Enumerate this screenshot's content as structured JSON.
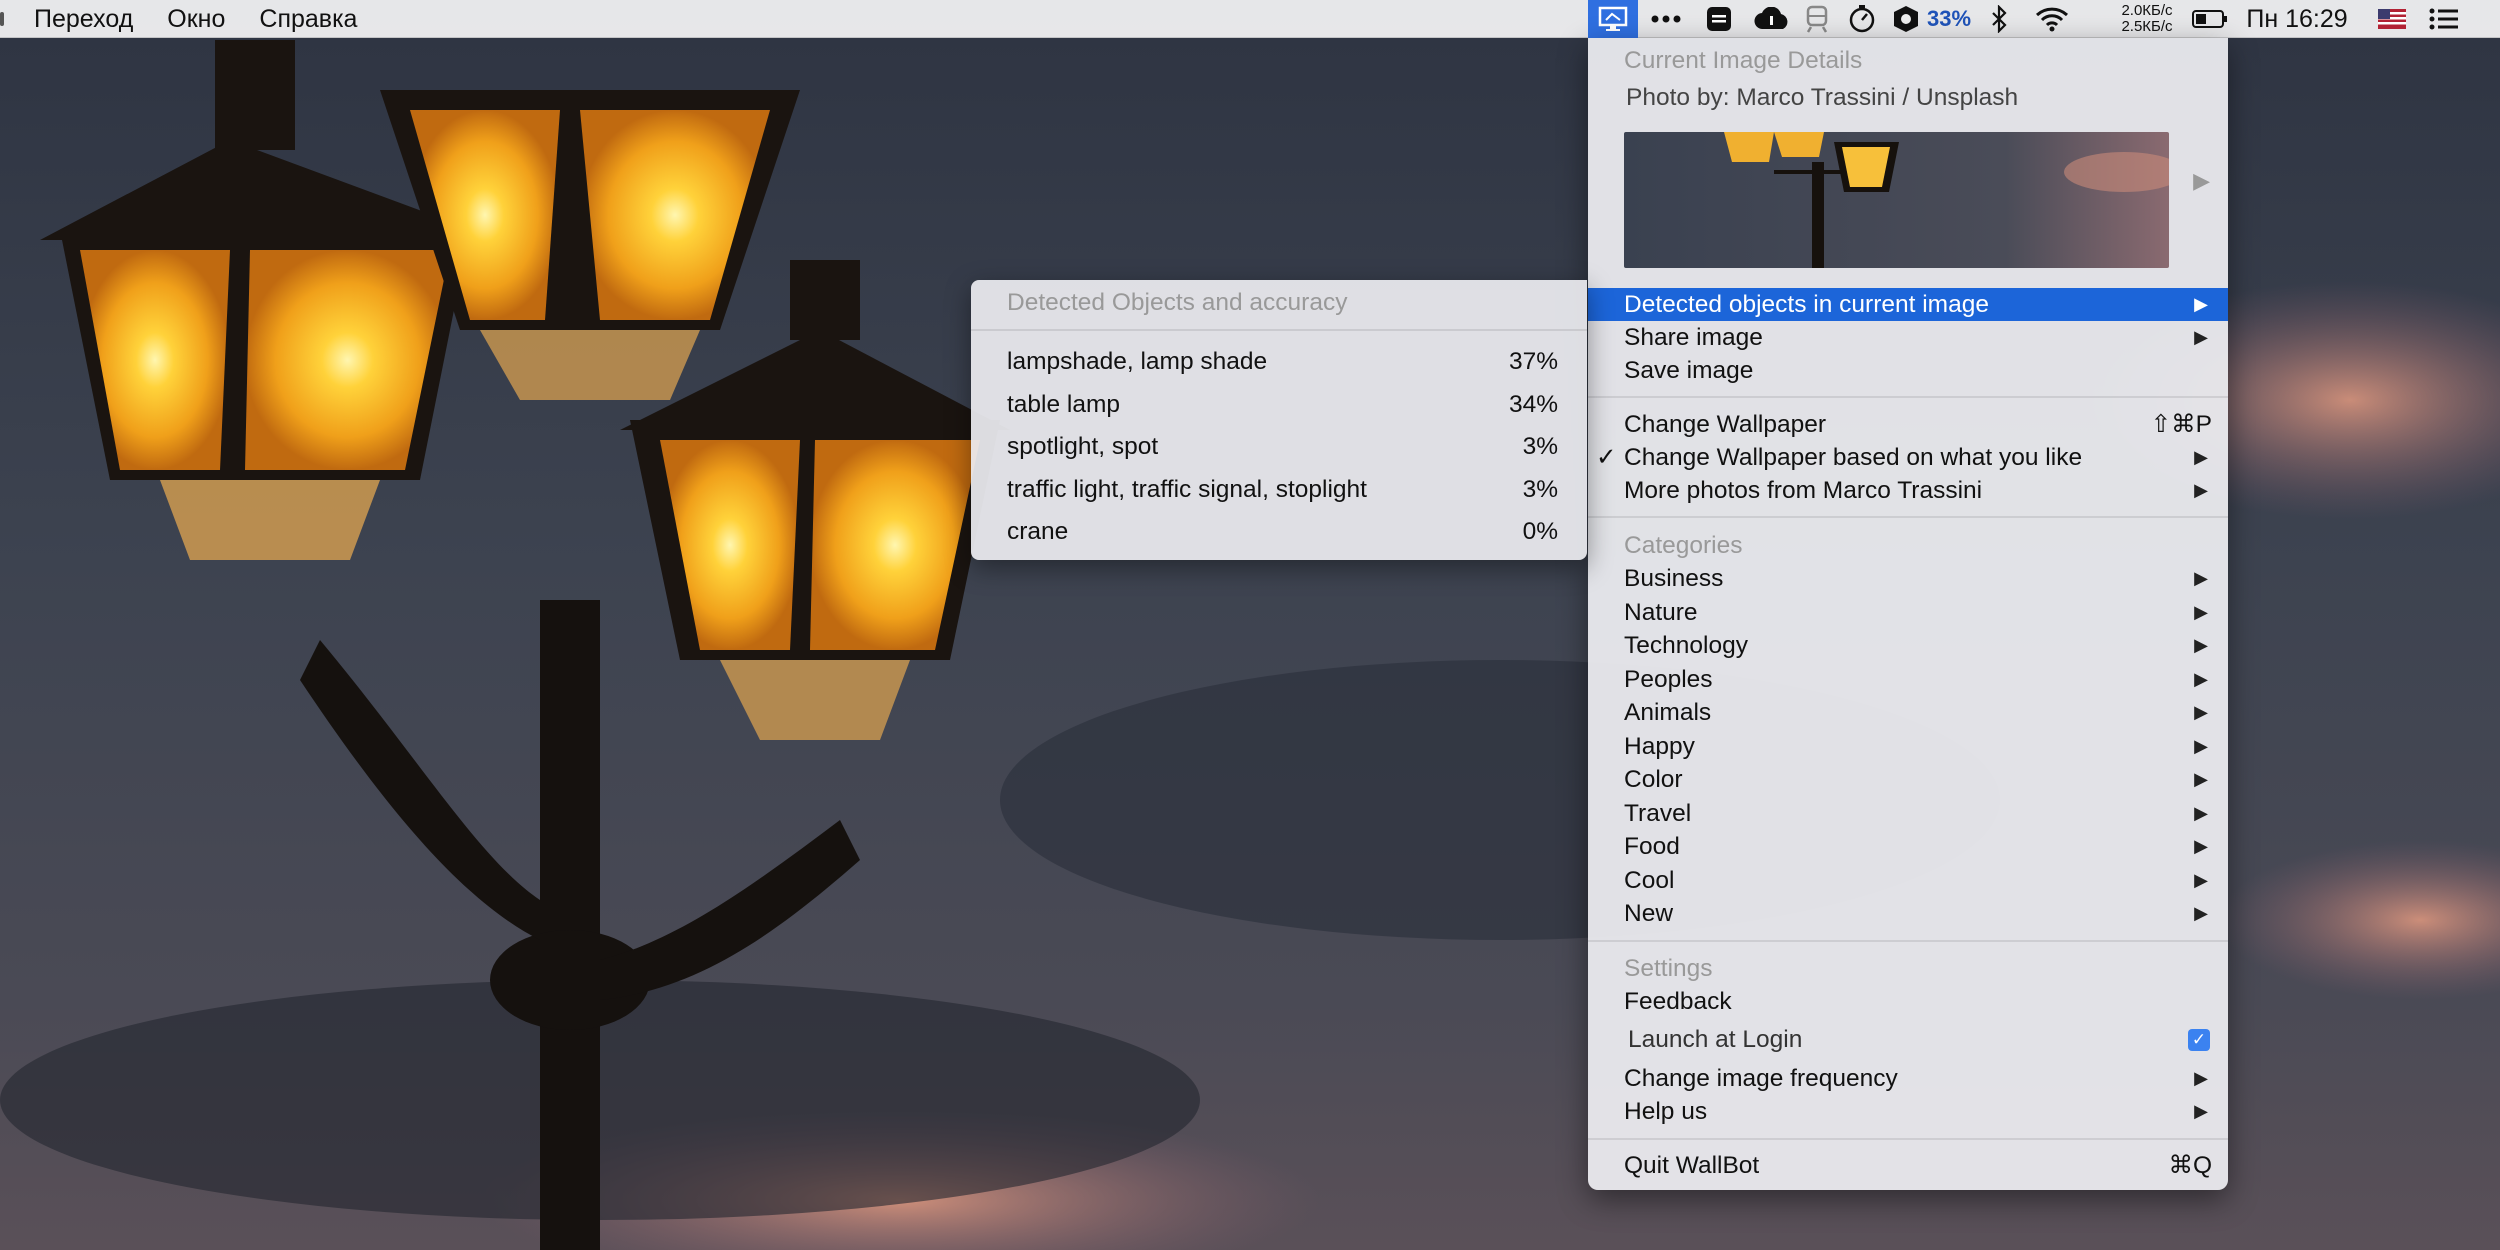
{
  "menubar": {
    "left_items": [
      "Переход",
      "Окно",
      "Справка"
    ],
    "status_icons": [
      "wallbot-monitor-icon",
      "more-dots-icon",
      "note-icon",
      "cloud-icon",
      "train-icon",
      "timer-icon",
      "shield-icon",
      "bluetooth-icon",
      "wifi-icon",
      "battery-icon",
      "flag-icon",
      "list-icon"
    ],
    "battery_percent": "33%",
    "net_up": "2.0КБ/с",
    "net_down": "2.5КБ/с",
    "clock": "Пн 16:29",
    "accent_color": "#2f6fe0"
  },
  "app_menu": {
    "details_header": "Current Image Details",
    "photo_credit": "Photo by: Marco Trassini / Unsplash",
    "detected_item": "Detected objects in current image",
    "share_item": "Share image",
    "save_item": "Save image",
    "change_wallpaper": "Change Wallpaper",
    "change_wallpaper_shortcut": "⇧⌘P",
    "change_based": "Change Wallpaper based on what you like",
    "change_based_checked": "✓",
    "more_photos": "More photos from Marco Trassini",
    "categories_header": "Categories",
    "categories": [
      "Business",
      "Nature",
      "Technology",
      "Peoples",
      "Animals",
      "Happy",
      "Color",
      "Travel",
      "Food",
      "Cool",
      "New"
    ],
    "settings_header": "Settings",
    "feedback": "Feedback",
    "launch_login": "Launch at Login",
    "launch_login_checked": true,
    "frequency": "Change image frequency",
    "help": "Help us",
    "quit": "Quit WallBot",
    "quit_shortcut": "⌘Q",
    "selection_color": "#1c65d9"
  },
  "submenu": {
    "header": "Detected Objects and accuracy",
    "objects": [
      {
        "label": "lampshade, lamp shade",
        "pct": "37%"
      },
      {
        "label": "table lamp",
        "pct": "34%"
      },
      {
        "label": "spotlight, spot",
        "pct": "3%"
      },
      {
        "label": "traffic light, traffic signal, stoplight",
        "pct": "3%"
      },
      {
        "label": "crane",
        "pct": "0%"
      }
    ]
  }
}
